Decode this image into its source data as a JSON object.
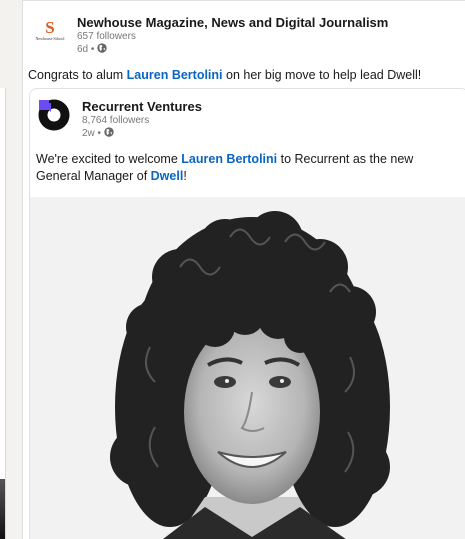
{
  "post": {
    "actor": {
      "name": "Newhouse Magazine, News and Digital Journalism",
      "followers": "657 followers",
      "time": "6d •",
      "logo_letter": "S",
      "logo_caption": "Newhouse School"
    },
    "commentary": {
      "before": "Congrats to alum ",
      "mention": "Lauren Bertolini",
      "after": " on her big move to help lead Dwell!"
    }
  },
  "reshared": {
    "actor": {
      "name": "Recurrent Ventures",
      "followers": "8,764 followers",
      "time": "2w •"
    },
    "text": {
      "part1": "We're excited to welcome ",
      "mention1": "Lauren Bertolini",
      "part2": " to Recurrent as the new General Manager of ",
      "mention2": "Dwell",
      "part3": "!"
    }
  },
  "colors": {
    "link": "#0a66c2",
    "newhouse_orange": "#e5591f",
    "recurrent_purple": "#6b4cf0"
  },
  "icons": {
    "visibility": "globe-icon"
  }
}
